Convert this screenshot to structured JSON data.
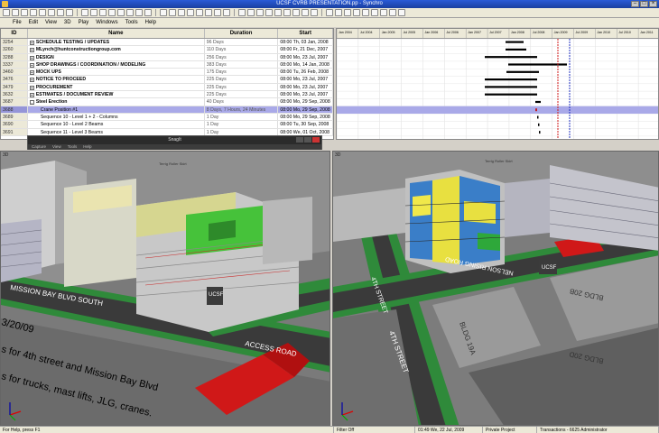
{
  "window": {
    "title": "UCSF CVRB PRESENTATION.pp - Synchro"
  },
  "menu": [
    "File",
    "Edit",
    "View",
    "3D",
    "Play",
    "Windows",
    "Tools",
    "Help"
  ],
  "table": {
    "headers": {
      "id": "ID",
      "name": "Name",
      "duration": "Duration",
      "start": "Start"
    },
    "rows": [
      {
        "id": "3254",
        "name": "SCHEDULE TESTING / UPDATES",
        "duration": "96 Days",
        "start": "08:00 Th, 03 Jan, 2008",
        "type": "sum",
        "exp": "+"
      },
      {
        "id": "3260",
        "name": "MLynch@huntconstructiongroup.com",
        "duration": "110 Days",
        "start": "08:00 Fr, 21 Dec, 2007",
        "type": "sum",
        "exp": "+"
      },
      {
        "id": "3288",
        "name": "DESIGN",
        "duration": "256 Days",
        "start": "08:00 Mo, 23 Jul, 2007",
        "type": "sum",
        "exp": "+"
      },
      {
        "id": "3337",
        "name": "SHOP DRAWINGS / COORDINATION / MODELING",
        "duration": "383 Days",
        "start": "08:00 Mo, 14 Jan, 2008",
        "type": "sum",
        "exp": "+"
      },
      {
        "id": "3460",
        "name": "MOCK UPS",
        "duration": "175 Days",
        "start": "08:00 Tu, 26 Feb, 2008",
        "type": "sum",
        "exp": "+"
      },
      {
        "id": "3476",
        "name": "NOTICE TO PROCEED",
        "duration": "225 Days",
        "start": "08:00 Mo, 23 Jul, 2007",
        "type": "sum",
        "exp": "+"
      },
      {
        "id": "3479",
        "name": "PROCUREMENT",
        "duration": "225 Days",
        "start": "08:00 Mo, 23 Jul, 2007",
        "type": "sum",
        "exp": "+"
      },
      {
        "id": "3632",
        "name": "ESTIMATES / DOCUMENT REVIEW",
        "duration": "225 Days",
        "start": "08:00 Mo, 23 Jul, 2007",
        "type": "sum",
        "exp": "+"
      },
      {
        "id": "3687",
        "name": "Steel Erection",
        "duration": "40 Days",
        "start": "08:00 Mo, 29 Sep, 2008",
        "type": "sum",
        "exp": "-"
      },
      {
        "id": "3688",
        "name": "Crane Position #1",
        "duration": "8 Days, 7 Hours, 24 Minutes",
        "start": "08:00 Mo, 29 Sep, 2008",
        "type": "sel",
        "exp": ""
      },
      {
        "id": "3689",
        "name": "Sequence 10 - Level 1 + 2 - Columns",
        "duration": "1 Day",
        "start": "08:00 Mo, 29 Sep, 2008",
        "type": "task",
        "exp": ""
      },
      {
        "id": "3690",
        "name": "Sequence 10 - Level 2 Beams",
        "duration": "1 Day",
        "start": "08:00 Tu, 30 Sep, 2008",
        "type": "task",
        "exp": ""
      },
      {
        "id": "3691",
        "name": "Sequence 11 - Level 3 Beams",
        "duration": "1 Day",
        "start": "08:00 We, 01 Oct, 2008",
        "type": "task",
        "exp": ""
      }
    ]
  },
  "gantt": {
    "periods": [
      "Jan 2004",
      "Jul 2004",
      "Jan 2005",
      "Jul 2005",
      "Jan 2006",
      "Jul 2006",
      "Jan 2007",
      "Jul 2007",
      "Jan 2008",
      "Jul 2008",
      "Jan 2009",
      "Jul 2009",
      "Jan 2010",
      "Jul 2010",
      "Jan 2011"
    ]
  },
  "snagit": {
    "title": "SnagIt",
    "menu": [
      "Capture",
      "View",
      "Tools",
      "Help"
    ]
  },
  "views": {
    "left": {
      "label": "3D",
      "sign": "UCSF",
      "road_main": "MISSION BAY BLVD SOUTH",
      "road_access": "ACCESS ROAD",
      "overlay_lines": [
        "3/20/09",
        "s for 4th street and Mission Bay Blvd",
        "s for trucks, mast lifts, JLG, cranes."
      ],
      "crane": "Terrig Roller Skirt"
    },
    "right": {
      "label": "3D",
      "sign": "UCSF",
      "road_main": "4TH STREET",
      "road_nelson": "NELSON RISING ROAD",
      "bldg_a": "BLDG 19A",
      "bldg_b": "BLDG 20D",
      "bldg_c": "BLDG 20B",
      "crane": "Terrig Roller Skirt"
    }
  },
  "status": {
    "help": "For Help, press F1",
    "filter": "Filter Off",
    "time": "01:49 We, 22 Jul, 2009",
    "project": "Private Project",
    "transactions": "Transactions - 6625  Administrator"
  }
}
